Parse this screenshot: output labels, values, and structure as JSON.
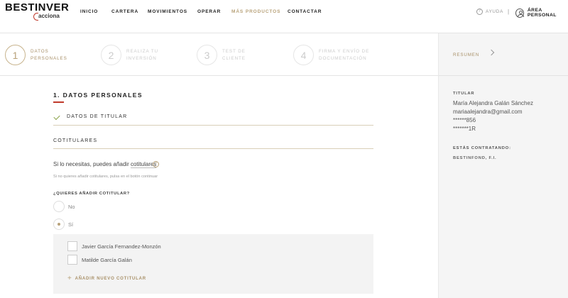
{
  "header": {
    "logo": "BESTINVER",
    "logo_sub": "acciona",
    "nav": [
      "INICIO",
      "CARTERA",
      "MOVIMIENTOS",
      "OPERAR",
      "MÁS PRODUCTOS",
      "CONTACTAR"
    ],
    "active_nav": "MÁS PRODUCTOS",
    "help": "AYUDA",
    "separator": "|",
    "area": "ÁREA PERSONAL"
  },
  "steps": [
    {
      "number": "1",
      "line1": "DATOS",
      "line2": "PERSONALES"
    },
    {
      "number": "2",
      "line1": "REALIZA TU",
      "line2": "INVERSIÓN"
    },
    {
      "number": "3",
      "line1": "TEST DE",
      "line2": "CLIENTE"
    },
    {
      "number": "4",
      "line1": "FIRMA Y ENVÍO DE",
      "line2": "DOCUMENTACIÓN"
    }
  ],
  "main": {
    "title": "1. DATOS PERSONALES",
    "titular_section": "DATOS DE TITULAR",
    "cotitulares_section": "COTITULARES",
    "add_text_pre": "Si lo necesitas, puedes añadir ",
    "add_text_link": "cotitulares",
    "hint": "Si no quieres añadir cotitulares, pulsa en el botón continuar",
    "question": "¿QUIERES AÑADIR COTITULAR?",
    "options": [
      "No",
      "Sí"
    ],
    "selected_option": "Sí",
    "cotitulares": [
      "Javier García Fernandez-Monzón",
      "Matilde García Galán"
    ],
    "add_button": "AÑADIR NUEVO COTITULAR"
  },
  "summary": {
    "resumen": "RESUMEN",
    "titular_label": "TITULAR",
    "name": "María Alejandra Galán Sánchez",
    "email": "mariaalejandra@gmail.com",
    "phone": "******856",
    "doc": "*******1R",
    "contracting_label": "ESTÁS CONTRATANDO:",
    "product": "BESTINFOND, F.I."
  },
  "colors": {
    "accent": "#b8a27a",
    "red": "#c0392b",
    "check": "#8aa34a"
  }
}
